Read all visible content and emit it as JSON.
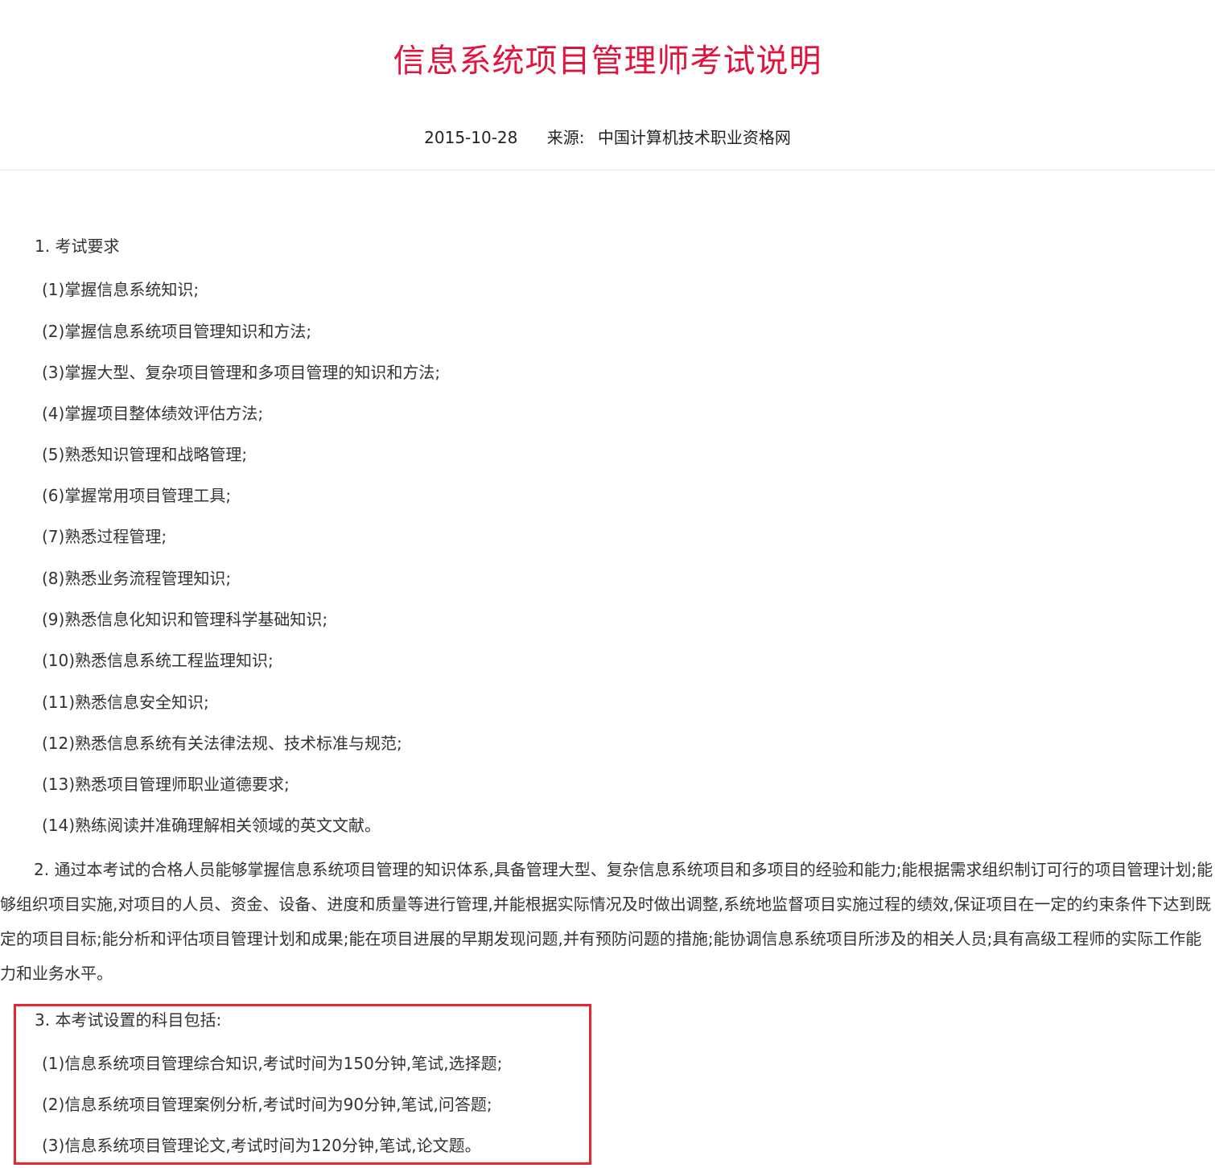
{
  "article": {
    "title": "信息系统项目管理师考试说明",
    "date": "2015-10-28",
    "source_label": "来源:",
    "source": "中国计算机技术职业资格网"
  },
  "section1": {
    "heading": "1. 考试要求",
    "items": [
      "(1)掌握信息系统知识;",
      "(2)掌握信息系统项目管理知识和方法;",
      "(3)掌握大型、复杂项目管理和多项目管理的知识和方法;",
      "(4)掌握项目整体绩效评估方法;",
      "(5)熟悉知识管理和战略管理;",
      "(6)掌握常用项目管理工具;",
      "(7)熟悉过程管理;",
      "(8)熟悉业务流程管理知识;",
      "(9)熟悉信息化知识和管理科学基础知识;",
      "(10)熟悉信息系统工程监理知识;",
      "(11)熟悉信息安全知识;",
      "(12)熟悉信息系统有关法律法规、技术标准与规范;",
      "(13)熟悉项目管理师职业道德要求;",
      "(14)熟练阅读并准确理解相关领域的英文文献。"
    ]
  },
  "section2": {
    "text": "2. 通过本考试的合格人员能够掌握信息系统项目管理的知识体系,具备管理大型、复杂信息系统项目和多项目的经验和能力;能根据需求组织制订可行的项目管理计划;能够组织项目实施,对项目的人员、资金、设备、进度和质量等进行管理,并能根据实际情况及时做出调整,系统地监督项目实施过程的绩效,保证项目在一定的约束条件下达到既定的项目目标;能分析和评估项目管理计划和成果;能在项目进展的早期发现问题,并有预防问题的措施;能协调信息系统项目所涉及的相关人员;具有高级工程师的实际工作能力和业务水平。"
  },
  "section3": {
    "heading": "3. 本考试设置的科目包括:",
    "items": [
      "(1)信息系统项目管理综合知识,考试时间为150分钟,笔试,选择题;",
      "(2)信息系统项目管理案例分析,考试时间为90分钟,笔试,问答题;",
      "(3)信息系统项目管理论文,考试时间为120分钟,笔试,论文题。"
    ]
  },
  "colors": {
    "title": "#e0143c",
    "highlight_border": "#e8262e",
    "body_text": "#333333"
  }
}
